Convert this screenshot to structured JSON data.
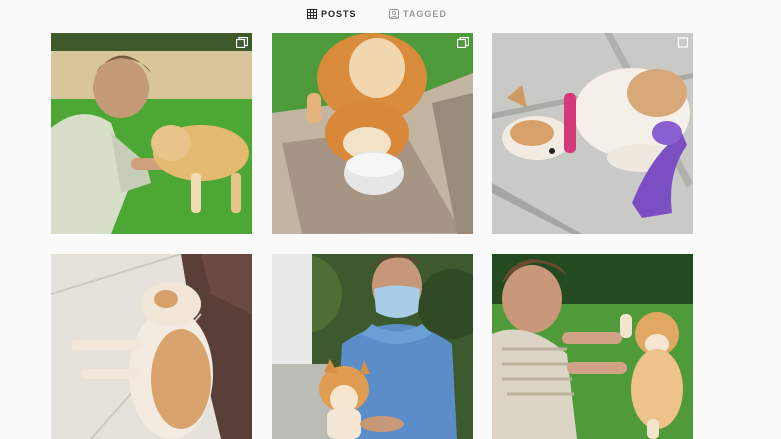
{
  "tabs": [
    {
      "label": "POSTS",
      "active": true,
      "icon": "grid-icon"
    },
    {
      "label": "TAGGED",
      "active": false,
      "icon": "tag-icon"
    }
  ],
  "colors": {
    "active_tab": "#262626",
    "inactive_tab": "#999999",
    "background": "#fafafa"
  },
  "posts": [
    {
      "badge": "carousel-icon"
    },
    {
      "badge": "carousel-icon"
    },
    {
      "badge": "carousel-icon"
    },
    {
      "badge": ""
    },
    {
      "badge": ""
    },
    {
      "badge": ""
    }
  ]
}
